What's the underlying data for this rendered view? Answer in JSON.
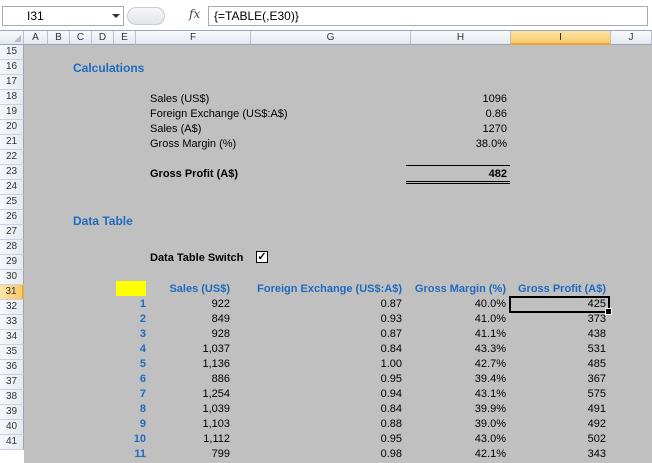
{
  "formula_bar": {
    "name_box": "I31",
    "fx_label": "fx",
    "formula": "{=TABLE(,E30)}"
  },
  "columns": [
    "A",
    "B",
    "C",
    "D",
    "E",
    "F",
    "G",
    "H",
    "I",
    "J"
  ],
  "selected_column": "I",
  "rows": [
    "15",
    "16",
    "17",
    "18",
    "19",
    "20",
    "21",
    "22",
    "23",
    "24",
    "25",
    "26",
    "27",
    "28",
    "29",
    "30",
    "31",
    "32",
    "33",
    "34",
    "35",
    "36",
    "37",
    "38",
    "39",
    "40",
    "41"
  ],
  "selected_row": "31",
  "calculations": {
    "title": "Calculations",
    "items": [
      {
        "label": "Sales (US$)",
        "value": "1096"
      },
      {
        "label": "Foreign Exchange (US$:A$)",
        "value": "0.86"
      },
      {
        "label": "Sales (A$)",
        "value": "1270"
      },
      {
        "label": "Gross Margin (%)",
        "value": "38.0%"
      }
    ],
    "gross_profit_label": "Gross Profit (A$)",
    "gross_profit_value": "482"
  },
  "data_table": {
    "title": "Data Table",
    "switch_label": "Data Table Switch",
    "switch_checked": true,
    "headers": [
      "Sales (US$)",
      "Foreign Exchange (US$:A$)",
      "Gross Margin (%)",
      "Gross Profit (A$)"
    ],
    "rows": [
      {
        "n": "1",
        "sales": "922",
        "fx": "0.87",
        "gm": "40.0%",
        "gp": "425"
      },
      {
        "n": "2",
        "sales": "849",
        "fx": "0.93",
        "gm": "41.0%",
        "gp": "373"
      },
      {
        "n": "3",
        "sales": "928",
        "fx": "0.87",
        "gm": "41.1%",
        "gp": "438"
      },
      {
        "n": "4",
        "sales": "1,037",
        "fx": "0.84",
        "gm": "43.3%",
        "gp": "531"
      },
      {
        "n": "5",
        "sales": "1,136",
        "fx": "1.00",
        "gm": "42.7%",
        "gp": "485"
      },
      {
        "n": "6",
        "sales": "886",
        "fx": "0.95",
        "gm": "39.4%",
        "gp": "367"
      },
      {
        "n": "7",
        "sales": "1,254",
        "fx": "0.94",
        "gm": "43.1%",
        "gp": "575"
      },
      {
        "n": "8",
        "sales": "1,039",
        "fx": "0.84",
        "gm": "39.9%",
        "gp": "491"
      },
      {
        "n": "9",
        "sales": "1,103",
        "fx": "0.88",
        "gm": "39.0%",
        "gp": "492"
      },
      {
        "n": "10",
        "sales": "1,112",
        "fx": "0.95",
        "gm": "43.0%",
        "gp": "502"
      },
      {
        "n": "11",
        "sales": "799",
        "fx": "0.98",
        "gm": "42.1%",
        "gp": "343"
      }
    ]
  },
  "colors": {
    "heading_blue": "#1f6bbf",
    "sheet_gray": "#c0c0c0",
    "input_cell": "#ffff00"
  }
}
